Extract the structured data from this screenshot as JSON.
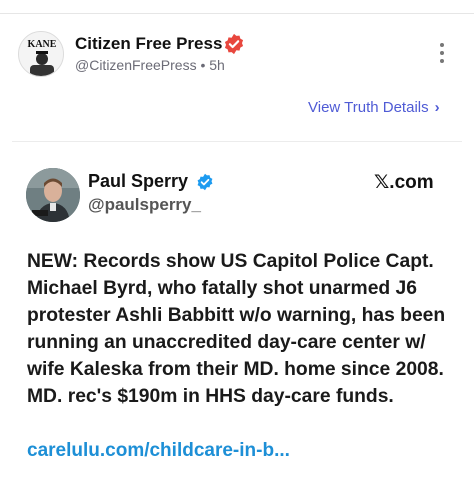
{
  "post": {
    "author_name": "Citizen Free Press",
    "author_handle": "@CitizenFreePress",
    "time": "5h",
    "avatar_text": "KANE",
    "verified_icon": "verified-badge-icon",
    "more_icon": "more-vertical-icon"
  },
  "details": {
    "label": "View Truth Details",
    "chevron": "›"
  },
  "tweet": {
    "name": "Paul Sperry",
    "handle": "@paulsperry_",
    "source": "𝕏.com",
    "text": "NEW: Records show US Capitol Police Capt. Michael Byrd, who fatally shot unarmed J6 protester Ashli Babbitt w/o warning, has been running an unaccredited day-care center w/ wife Kaleska from their MD. home since 2008. MD. rec's $190m in HHS day-care funds.",
    "link": "carelulu.com/childcare-in-b..."
  },
  "colors": {
    "verified_main": "#e8473e",
    "verified_tweet": "#1d9bf0",
    "link": "#1d8fd6",
    "details": "#4f5bd5"
  }
}
